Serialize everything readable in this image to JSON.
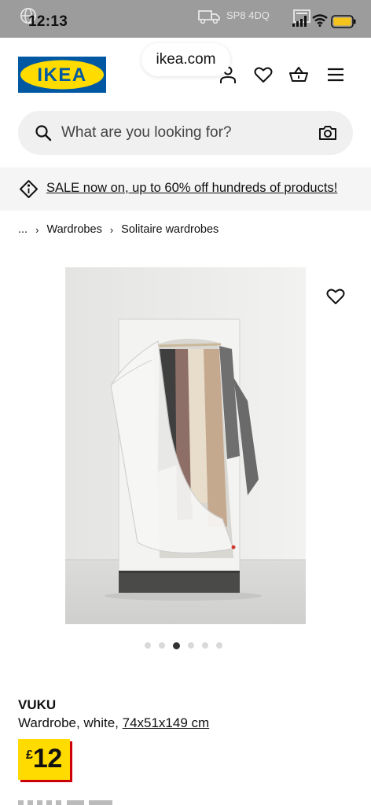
{
  "status_bar": {
    "time": "12:13",
    "postcode": "SP8 4DQ",
    "icons": [
      "globe-icon",
      "truck-icon",
      "cast-icon",
      "signal-icon",
      "wifi-icon",
      "battery-icon"
    ]
  },
  "browser": {
    "url": "ikea.com"
  },
  "header": {
    "logo_text": "IKEA",
    "icons": [
      "account-icon",
      "favourites-icon",
      "basket-icon",
      "menu-icon"
    ],
    "colors": {
      "logo_blue": "#0058a3",
      "logo_yellow": "#ffdb00"
    }
  },
  "search": {
    "placeholder": "What are you looking for?"
  },
  "banner": {
    "text": "SALE now on, up to 60% off hundreds of products!"
  },
  "breadcrumb": {
    "ellipsis": "...",
    "items": [
      "Wardrobes",
      "Solitaire wardrobes"
    ]
  },
  "gallery": {
    "image_count": 6,
    "active_index": 2
  },
  "product": {
    "name": "VUKU",
    "description": "Wardrobe, white,",
    "dimensions": "74x51x149 cm",
    "price_currency": "£",
    "price_value": "12",
    "colors": {
      "price_bg": "#ffdb00",
      "price_shadow": "#cc0008"
    }
  }
}
